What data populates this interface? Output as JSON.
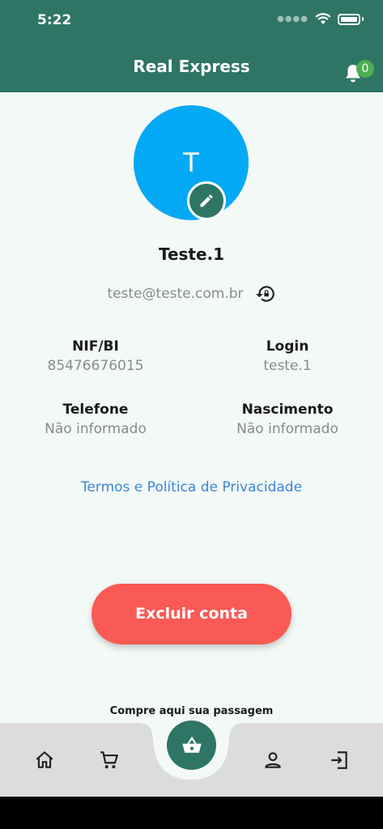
{
  "status_bar": {
    "time": "5:22"
  },
  "header": {
    "title": "Real Express",
    "notification_count": "0"
  },
  "profile": {
    "avatar_initial": "T",
    "name": "Teste.1",
    "email": "teste@teste.com.br"
  },
  "info": {
    "nif_label": "NIF/BI",
    "nif_value": "85476676015",
    "login_label": "Login",
    "login_value": "teste.1",
    "phone_label": "Telefone",
    "phone_value": "Não informado",
    "birth_label": "Nascimento",
    "birth_value": "Não informado"
  },
  "terms_link": "Termos e Política de Privacidade",
  "delete_button": "Excluir conta",
  "buy_caption": "Compre aqui sua passagem",
  "colors": {
    "primary": "#2e7565",
    "avatar": "#03a9f4",
    "danger": "#fa5a56",
    "link": "#3d85d8",
    "badge": "#4caf50"
  },
  "icons": [
    "bell-icon",
    "pencil-icon",
    "lock-reset-icon",
    "home-icon",
    "cart-icon",
    "basket-icon",
    "person-icon",
    "logout-icon"
  ]
}
